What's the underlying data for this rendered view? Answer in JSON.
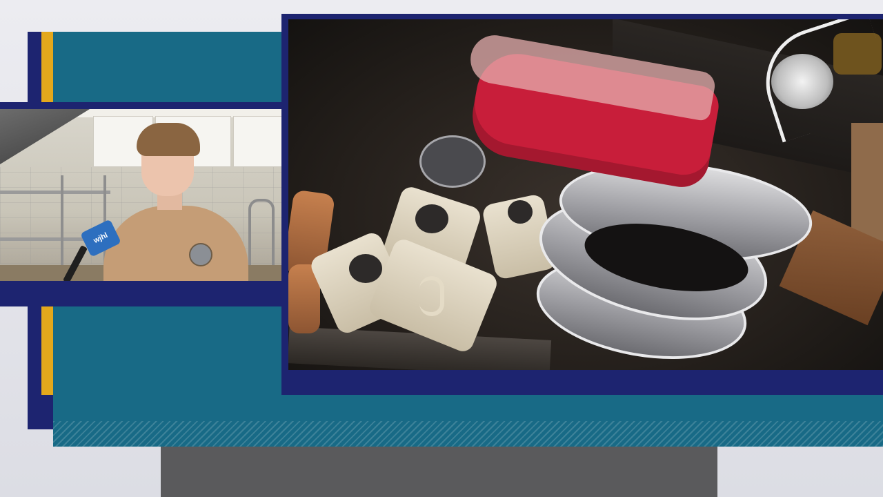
{
  "broadcast": {
    "layout": "double-box",
    "colors": {
      "navy": "#1d2470",
      "gold": "#e4a81c",
      "teal": "#186a86",
      "background": "#e4e4ea",
      "bottom_gray": "#5a5a5c"
    }
  },
  "interview_feed": {
    "microphone_flag_text": "wjhl"
  },
  "b_roll_feed": {}
}
